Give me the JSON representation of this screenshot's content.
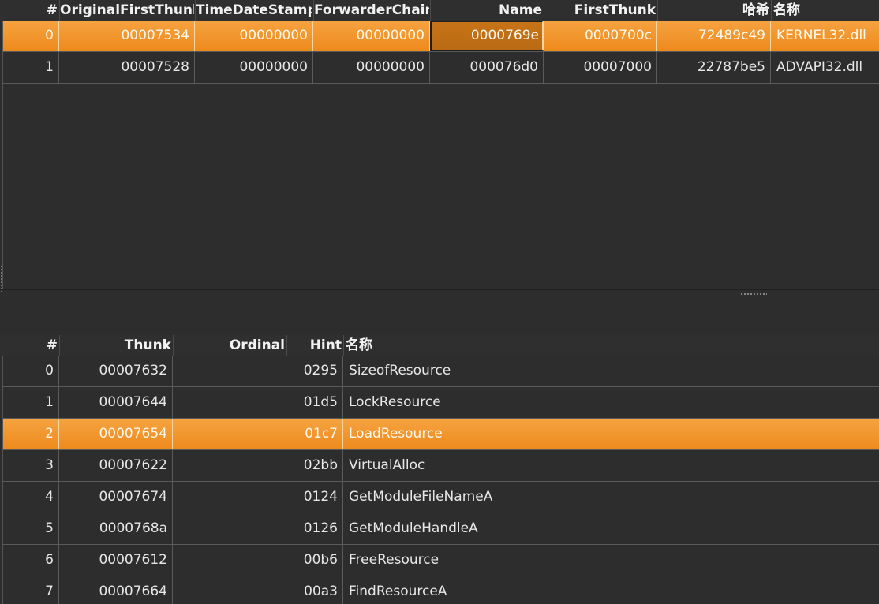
{
  "import_descriptors": {
    "headers": [
      "#",
      "OriginalFirstThunk",
      "TimeDateStamp",
      "ForwarderChain",
      "Name",
      "FirstThunk",
      "哈希",
      "名称"
    ],
    "rows": [
      {
        "index": "0",
        "original_first_thunk": "00007534",
        "time_date_stamp": "00000000",
        "forwarder_chain": "00000000",
        "name": "0000769e",
        "first_thunk": "0000700c",
        "hash": "72489c49",
        "dll": "KERNEL32.dll"
      },
      {
        "index": "1",
        "original_first_thunk": "00007528",
        "time_date_stamp": "00000000",
        "forwarder_chain": "00000000",
        "name": "000076d0",
        "first_thunk": "00007000",
        "hash": "22787be5",
        "dll": "ADVAPI32.dll"
      }
    ],
    "selected_row": 0
  },
  "imported_functions": {
    "headers": [
      "#",
      "Thunk",
      "Ordinal",
      "Hint",
      "名称"
    ],
    "rows": [
      {
        "index": "0",
        "thunk": "00007632",
        "ordinal": "",
        "hint": "0295",
        "name": "SizeofResource"
      },
      {
        "index": "1",
        "thunk": "00007644",
        "ordinal": "",
        "hint": "01d5",
        "name": "LockResource"
      },
      {
        "index": "2",
        "thunk": "00007654",
        "ordinal": "",
        "hint": "01c7",
        "name": "LoadResource"
      },
      {
        "index": "3",
        "thunk": "00007622",
        "ordinal": "",
        "hint": "02bb",
        "name": "VirtualAlloc"
      },
      {
        "index": "4",
        "thunk": "00007674",
        "ordinal": "",
        "hint": "0124",
        "name": "GetModuleFileNameA"
      },
      {
        "index": "5",
        "thunk": "0000768a",
        "ordinal": "",
        "hint": "0126",
        "name": "GetModuleHandleA"
      },
      {
        "index": "6",
        "thunk": "00007612",
        "ordinal": "",
        "hint": "00b6",
        "name": "FreeResource"
      },
      {
        "index": "7",
        "thunk": "00007664",
        "ordinal": "",
        "hint": "00a3",
        "name": "FindResourceA"
      }
    ],
    "selected_row": 2
  },
  "colors": {
    "background": "#2d2d2d",
    "selection": "#f29630",
    "focus_cell": "#c0701a",
    "grid": "#5a5a5a"
  }
}
